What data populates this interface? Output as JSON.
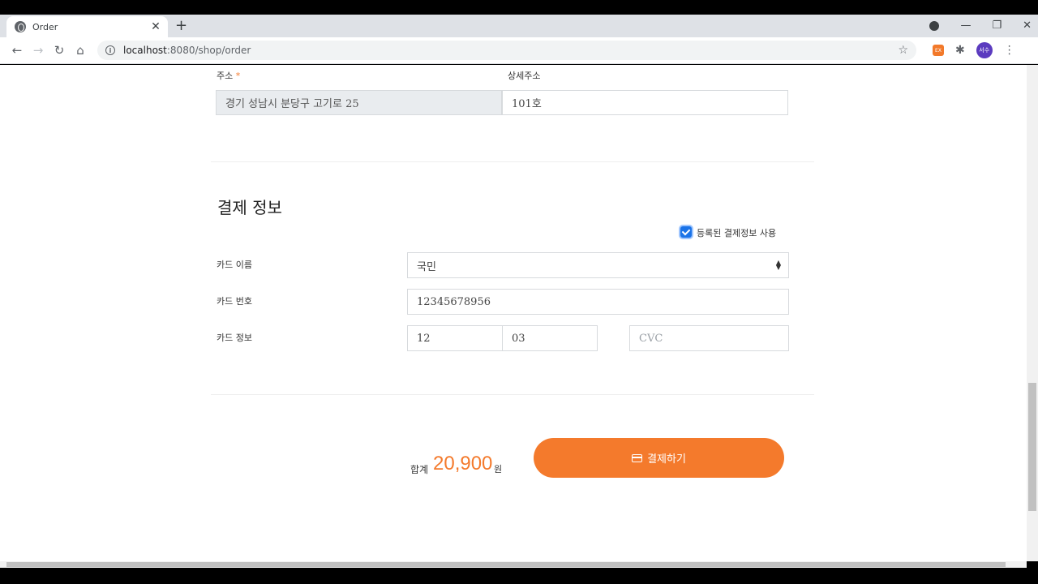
{
  "browser": {
    "tab_title": "Order",
    "tab_close": "✕",
    "new_tab": "+",
    "url_host": "localhost",
    "url_path": ":8080/shop/order",
    "extension_label": "EX",
    "avatar_text": "서수"
  },
  "address": {
    "address_label": "주소",
    "required_mark": "*",
    "address_value": "경기 성남시 분당구 고기로 25",
    "detail_label": "상세주소",
    "detail_value": "101호"
  },
  "payment": {
    "title": "결제 정보",
    "use_saved_label": "등록된 결제정보 사용",
    "use_saved_checked": true,
    "card_type_label": "카드 이름",
    "card_type_value": "국민",
    "card_number_label": "카드 번호",
    "card_number_value": "12345678956",
    "card_info_label": "카드 정보",
    "expiry_month_value": "12",
    "expiry_year_value": "03",
    "cvc_placeholder": "CVC"
  },
  "summary": {
    "total_label": "합계",
    "total_amount": "20,900",
    "total_unit": "원",
    "pay_button_label": "결제하기"
  },
  "colors": {
    "accent": "#f47a2c",
    "checkbox": "#1a73e8"
  }
}
